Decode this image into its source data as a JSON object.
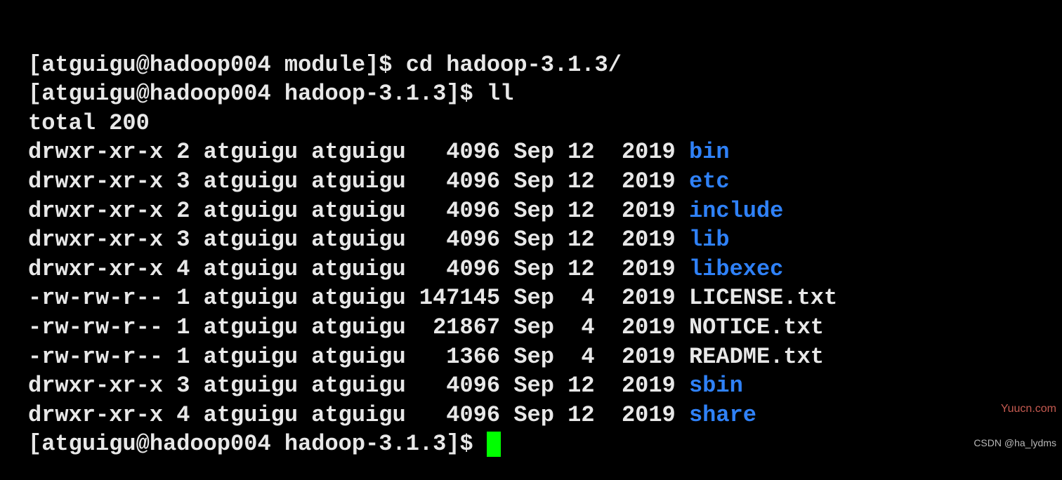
{
  "prompts": {
    "line1_prompt": "[atguigu@hadoop004 module]$ ",
    "line1_cmd": "cd hadoop-3.1.3/",
    "line2_prompt": "[atguigu@hadoop004 hadoop-3.1.3]$ ",
    "line2_cmd": "ll",
    "total": "total 200",
    "final_prompt": "[atguigu@hadoop004 hadoop-3.1.3]$ "
  },
  "listing": [
    {
      "perms": "drwxr-xr-x",
      "links": "2",
      "owner": "atguigu",
      "group": "atguigu",
      "size": "  4096",
      "date": "Sep 12  2019",
      "name": "bin",
      "type": "dir"
    },
    {
      "perms": "drwxr-xr-x",
      "links": "3",
      "owner": "atguigu",
      "group": "atguigu",
      "size": "  4096",
      "date": "Sep 12  2019",
      "name": "etc",
      "type": "dir"
    },
    {
      "perms": "drwxr-xr-x",
      "links": "2",
      "owner": "atguigu",
      "group": "atguigu",
      "size": "  4096",
      "date": "Sep 12  2019",
      "name": "include",
      "type": "dir"
    },
    {
      "perms": "drwxr-xr-x",
      "links": "3",
      "owner": "atguigu",
      "group": "atguigu",
      "size": "  4096",
      "date": "Sep 12  2019",
      "name": "lib",
      "type": "dir"
    },
    {
      "perms": "drwxr-xr-x",
      "links": "4",
      "owner": "atguigu",
      "group": "atguigu",
      "size": "  4096",
      "date": "Sep 12  2019",
      "name": "libexec",
      "type": "dir"
    },
    {
      "perms": "-rw-rw-r--",
      "links": "1",
      "owner": "atguigu",
      "group": "atguigu",
      "size": "147145",
      "date": "Sep  4  2019",
      "name": "LICENSE.txt",
      "type": "file"
    },
    {
      "perms": "-rw-rw-r--",
      "links": "1",
      "owner": "atguigu",
      "group": "atguigu",
      "size": " 21867",
      "date": "Sep  4  2019",
      "name": "NOTICE.txt",
      "type": "file"
    },
    {
      "perms": "-rw-rw-r--",
      "links": "1",
      "owner": "atguigu",
      "group": "atguigu",
      "size": "  1366",
      "date": "Sep  4  2019",
      "name": "README.txt",
      "type": "file"
    },
    {
      "perms": "drwxr-xr-x",
      "links": "3",
      "owner": "atguigu",
      "group": "atguigu",
      "size": "  4096",
      "date": "Sep 12  2019",
      "name": "sbin",
      "type": "dir"
    },
    {
      "perms": "drwxr-xr-x",
      "links": "4",
      "owner": "atguigu",
      "group": "atguigu",
      "size": "  4096",
      "date": "Sep 12  2019",
      "name": "share",
      "type": "dir"
    }
  ],
  "watermarks": {
    "right": "Yuucn.com",
    "bottom": "CSDN @ha_lydms"
  }
}
